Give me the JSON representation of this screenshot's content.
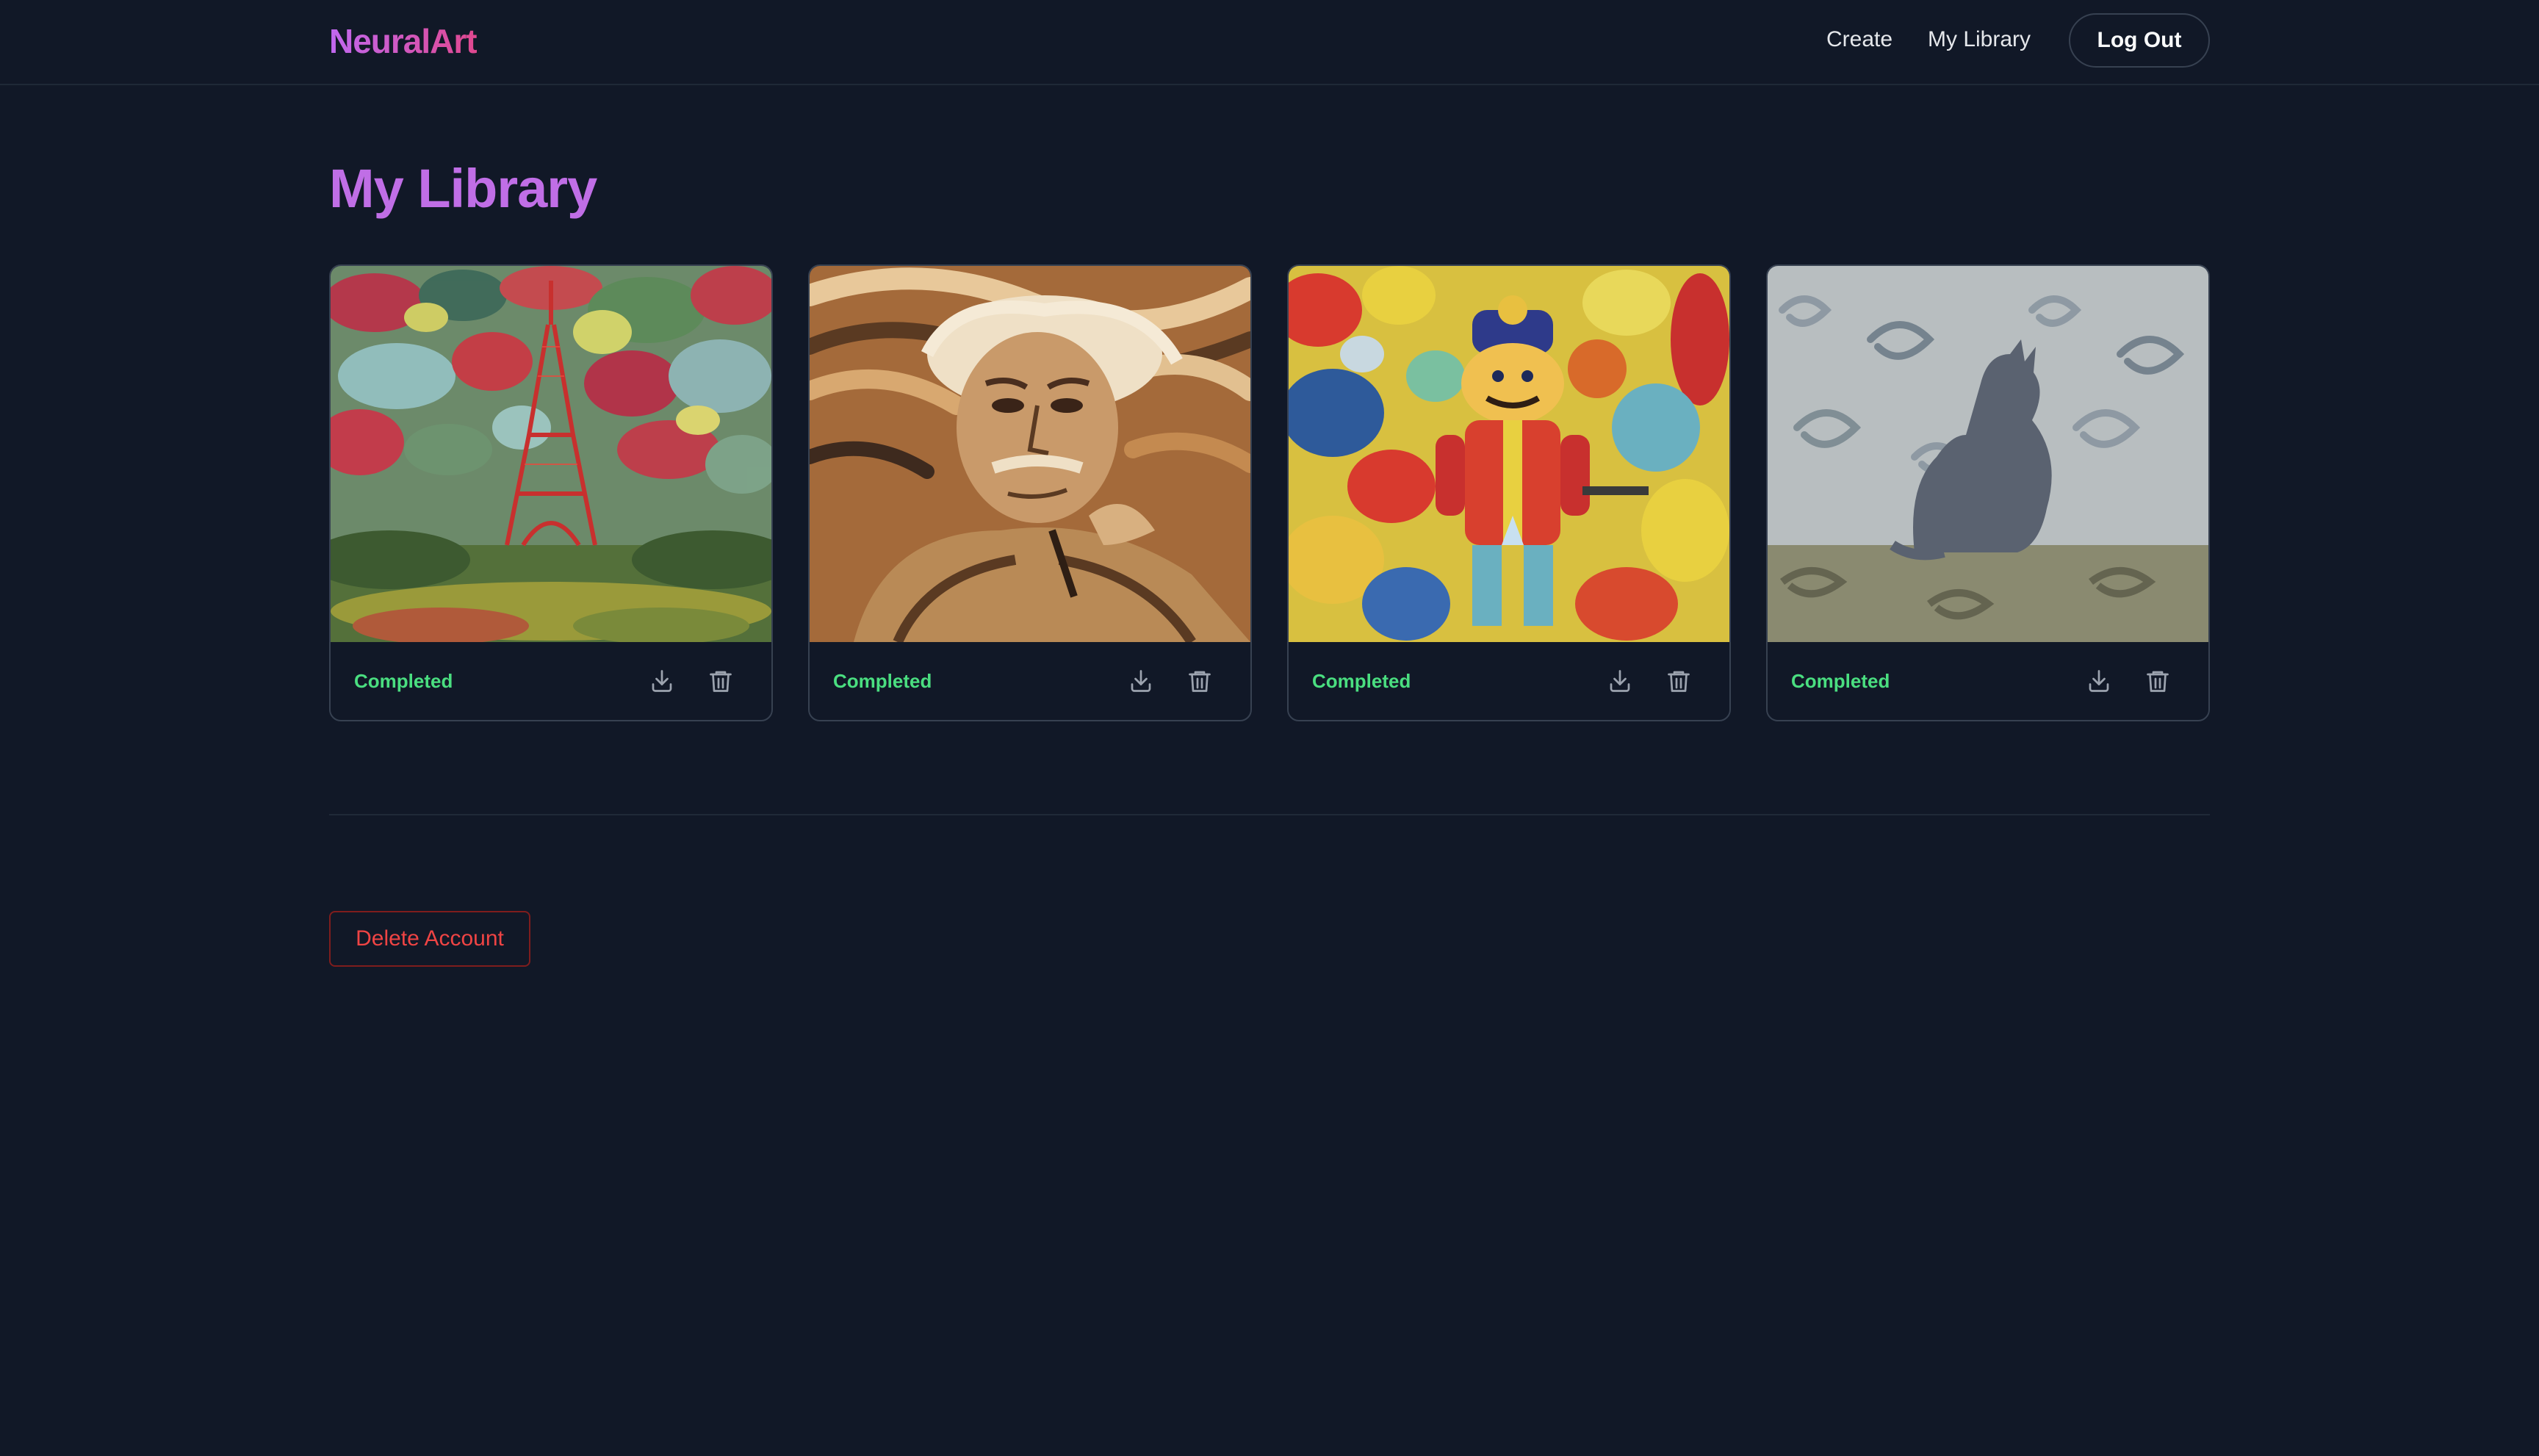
{
  "header": {
    "logo": "NeuralArt",
    "nav": {
      "create": "Create",
      "my_library": "My Library"
    },
    "logout_label": "Log Out"
  },
  "page": {
    "title": "My Library"
  },
  "library": {
    "items": [
      {
        "artwork": "eiffel-tower-painting",
        "status": "Completed"
      },
      {
        "artwork": "einstein-portrait-painting",
        "status": "Completed"
      },
      {
        "artwork": "nutcracker-painting",
        "status": "Completed"
      },
      {
        "artwork": "cat-silhouette-painting",
        "status": "Completed"
      }
    ],
    "actions": {
      "download_icon": "download-icon",
      "delete_icon": "trash-icon"
    }
  },
  "account": {
    "delete_label": "Delete Account"
  },
  "colors": {
    "background": "#111827",
    "accent": "#c06ee6",
    "status_completed": "#4ade80",
    "danger": "#ef4444"
  }
}
